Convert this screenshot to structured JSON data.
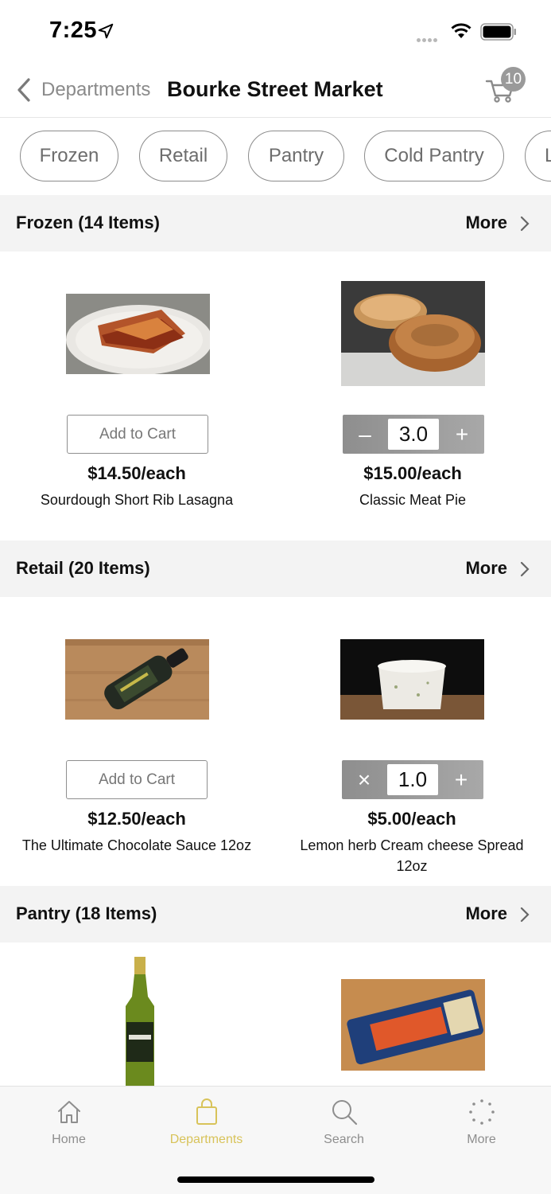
{
  "status": {
    "time": "7:25"
  },
  "header": {
    "back_label": "Departments",
    "title": "Bourke Street Market",
    "cart_count": "10"
  },
  "chips": [
    "Frozen",
    "Retail",
    "Pantry",
    "Cold Pantry",
    "L"
  ],
  "sections": [
    {
      "title": "Frozen (14 Items)",
      "more": "More",
      "products": [
        {
          "price": "$14.50/each",
          "name": "Sourdough Short Rib Lasagna",
          "action": "Add to Cart"
        },
        {
          "price": "$15.00/each",
          "name": "Classic Meat Pie",
          "qty": "3.0",
          "minus": "–",
          "plus": "+"
        }
      ]
    },
    {
      "title": "Retail (20 Items)",
      "more": "More",
      "products": [
        {
          "price": "$12.50/each",
          "name": "The Ultimate Chocolate Sauce 12oz",
          "action": "Add to Cart"
        },
        {
          "price": "$5.00/each",
          "name": "Lemon herb Cream cheese Spread 12oz",
          "qty": "1.0",
          "minus": "×",
          "plus": "+"
        }
      ]
    },
    {
      "title": "Pantry (18 Items)",
      "more": "More",
      "products": []
    }
  ],
  "tabs": [
    {
      "label": "Home",
      "icon": "home-icon"
    },
    {
      "label": "Departments",
      "icon": "shopping-bag-icon",
      "active": true
    },
    {
      "label": "Search",
      "icon": "search-icon"
    },
    {
      "label": "More",
      "icon": "more-dots-icon"
    }
  ],
  "colors": {
    "accent": "#d8c35a",
    "section_bg": "#f3f3f3",
    "stepper": "#9a9a9a"
  }
}
